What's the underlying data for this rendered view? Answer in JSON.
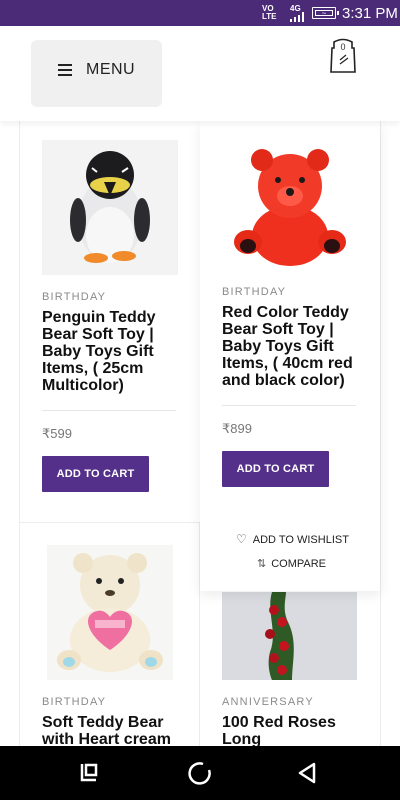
{
  "status_bar": {
    "network_label": "VOL LTE",
    "network_top": "VO",
    "network_bottom": "LTE",
    "signal_label": "4G",
    "time": "3:31 PM"
  },
  "header": {
    "menu_label": "MENU",
    "cart_count": "0"
  },
  "products": [
    {
      "category": "BIRTHDAY",
      "title_lines": [
        " Penguin Teddy",
        "Bear Soft Toy |",
        "Baby Toys Gift",
        "Items, ( 25cm",
        "Multicolor)"
      ],
      "price": "₹599",
      "add_to_cart": "ADD TO CART"
    },
    {
      "category": "BIRTHDAY",
      "title_lines": [
        " Red Color Teddy",
        "Bear Soft Toy |",
        "Baby Toys Gift",
        "Items, ( 40cm red",
        "and black color)"
      ],
      "price": "₹899",
      "add_to_cart": "ADD TO CART",
      "wishlist": "ADD TO WISHLIST",
      "compare": "COMPARE"
    },
    {
      "category": "BIRTHDAY",
      "title_lines": [
        " Soft Teddy Bear",
        "with Heart cream"
      ]
    },
    {
      "category": "ANNIVERSARY",
      "title_lines": [
        "100 Red Roses",
        "Long"
      ]
    }
  ],
  "colors": {
    "brand": "#4b2a78",
    "button": "#55308a",
    "navbar": "#000000"
  }
}
